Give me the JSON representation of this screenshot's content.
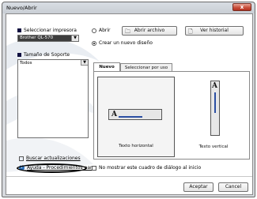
{
  "window": {
    "title": "Nuevo/Abrir",
    "close_label": "x"
  },
  "printer": {
    "label": "Seleccionar impresora",
    "selected": "Brother QL-570"
  },
  "tape_size": {
    "label": "Tamaño de Soporte",
    "selected": "Todos"
  },
  "mode": {
    "open_label": "Abrir",
    "create_label": "Crear un nuevo diseño",
    "selected": "create"
  },
  "buttons": {
    "open_file": "Abrir archivo",
    "history": "Ver historial",
    "accept": "Aceptar",
    "cancel": "Cancel"
  },
  "tabs": [
    {
      "label": "Nuevo",
      "active": true
    },
    {
      "label": "Seleccionar por uso",
      "active": false
    }
  ],
  "layouts": [
    {
      "caption": "Texto horizontal",
      "glyph": "A",
      "selected": true
    },
    {
      "caption": "Texto vertical",
      "glyph": "A",
      "selected": false
    }
  ],
  "links": {
    "updates": "Buscar actualizaciones",
    "help": "Ayuda - Procedimientos para"
  },
  "dont_show": {
    "label": "No mostrar este cuadro de diálogo al inicio",
    "checked": false
  },
  "colors": {
    "accent_blue": "#2b4fa3",
    "help_blue": "#2e6fb7",
    "close_red": "#c9523e"
  }
}
